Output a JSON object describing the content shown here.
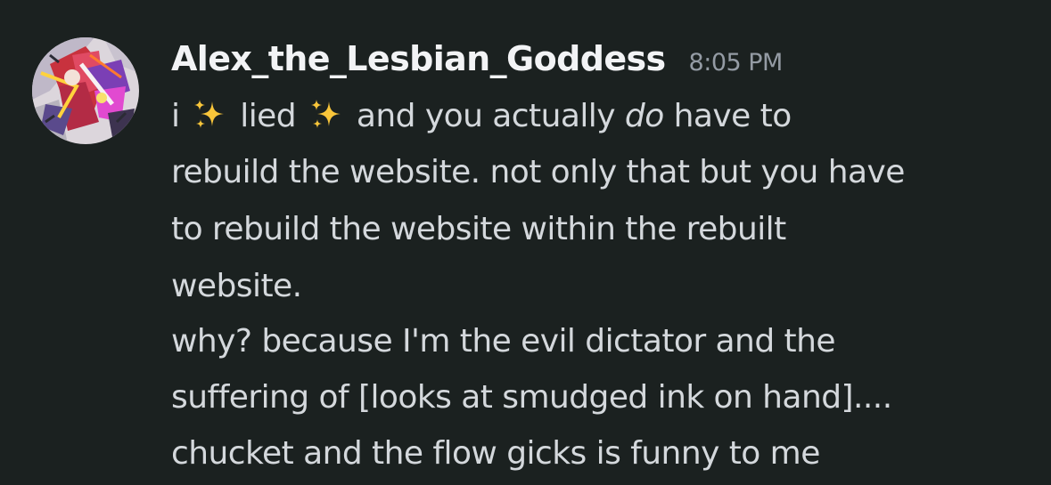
{
  "message": {
    "author": "Alex_the_Lesbian_Goddess",
    "timestamp": "8:05 PM",
    "line1": {
      "t1": "i",
      "t2": "lied",
      "t3": "and you actually",
      "emphasis": "do",
      "t4": "have to"
    },
    "lines": [
      "rebuild the website. not only that but you have",
      "to rebuild the website within the rebuilt",
      "website.",
      "why? because I'm the evil dictator and the",
      "suffering of [looks at smudged ink on hand]....",
      "chucket and the flow gicks is funny to me"
    ],
    "emoji": "sparkles-icon",
    "colors": {
      "background": "#1b2120",
      "username": "#f2f3f5",
      "timestamp": "#949ba4",
      "text": "#d4d8dc"
    }
  }
}
